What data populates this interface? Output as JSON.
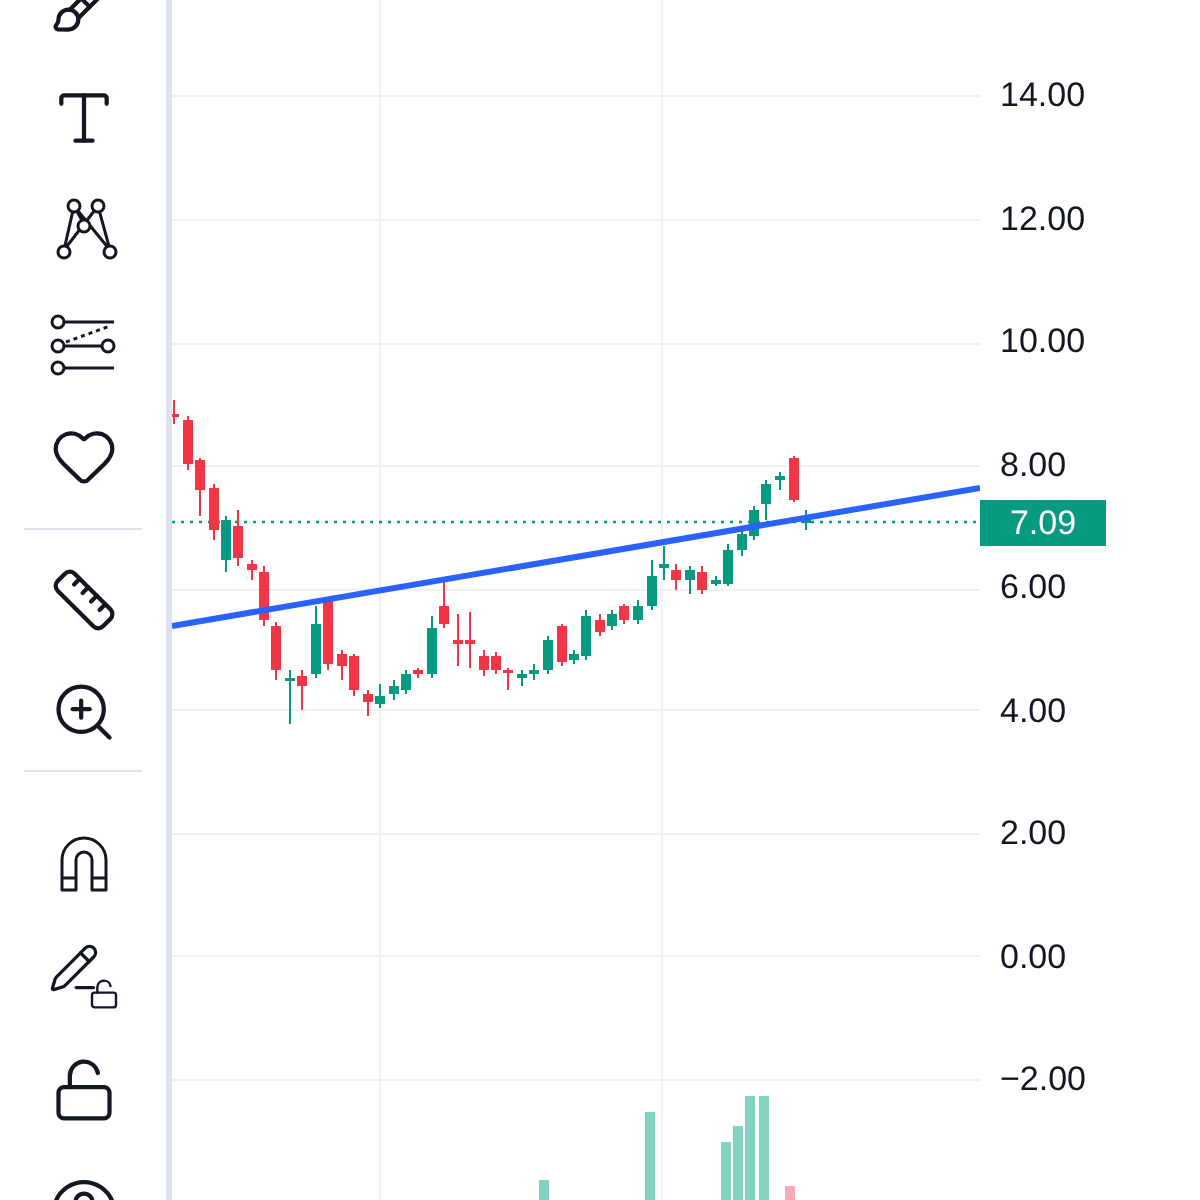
{
  "price_axis": {
    "labels": [
      "14.00",
      "12.00",
      "10.00",
      "8.00",
      "6.00",
      "4.00",
      "2.00",
      "0.00",
      "−2.00"
    ]
  },
  "last_price": {
    "label": "7.09"
  }
}
